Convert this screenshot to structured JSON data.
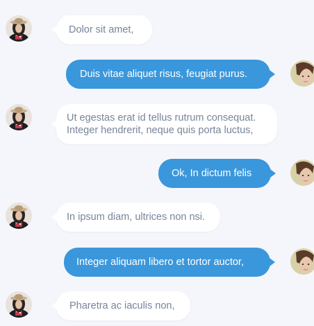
{
  "colors": {
    "background": "#f5f6fb",
    "incoming_bubble": "#ffffff",
    "incoming_text": "#76859a",
    "outgoing_bubble": "#3a97dc",
    "outgoing_text": "#ffffff"
  },
  "messages": [
    {
      "direction": "incoming",
      "avatar": "female-avatar-icon",
      "lines": [
        "Dolor sit amet,"
      ]
    },
    {
      "direction": "outgoing",
      "avatar": "male-avatar-icon",
      "lines": [
        "Duis vitae aliquet risus, feugiat purus."
      ]
    },
    {
      "direction": "incoming",
      "avatar": "female-avatar-icon",
      "lines": [
        "Ut egestas erat id tellus rutrum consequat.",
        "Integer hendrerit, neque quis porta luctus,"
      ]
    },
    {
      "direction": "outgoing",
      "avatar": "male-avatar-icon",
      "lines": [
        "Ok, In dictum felis"
      ]
    },
    {
      "direction": "incoming",
      "avatar": "female-avatar-icon",
      "lines": [
        "In ipsum diam, ultrices non nsi."
      ]
    },
    {
      "direction": "outgoing",
      "avatar": "male-avatar-icon",
      "lines": [
        "Integer aliquam libero et tortor auctor,"
      ]
    },
    {
      "direction": "incoming",
      "avatar": "female-avatar-icon",
      "lines": [
        "Pharetra ac iaculis non,"
      ]
    }
  ]
}
